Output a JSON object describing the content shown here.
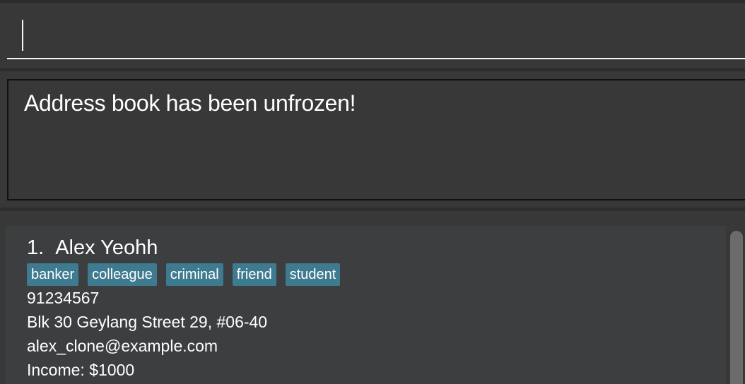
{
  "command_box": {
    "value": "",
    "placeholder": ""
  },
  "result_display": {
    "message": "Address book has been unfrozen!"
  },
  "person_list": {
    "persons": [
      {
        "index": "1.",
        "name": "Alex Yeohh",
        "tags": [
          "banker",
          "colleague",
          "criminal",
          "friend",
          "student"
        ],
        "phone": "91234567",
        "address": "Blk 30 Geylang Street 29, #06-40",
        "email": "alex_clone@example.com",
        "income": "Income: $1000"
      }
    ]
  },
  "colors": {
    "background": "#383838",
    "card": "#3c3e3f",
    "tag": "#3e7b91",
    "text": "#ffffff"
  }
}
